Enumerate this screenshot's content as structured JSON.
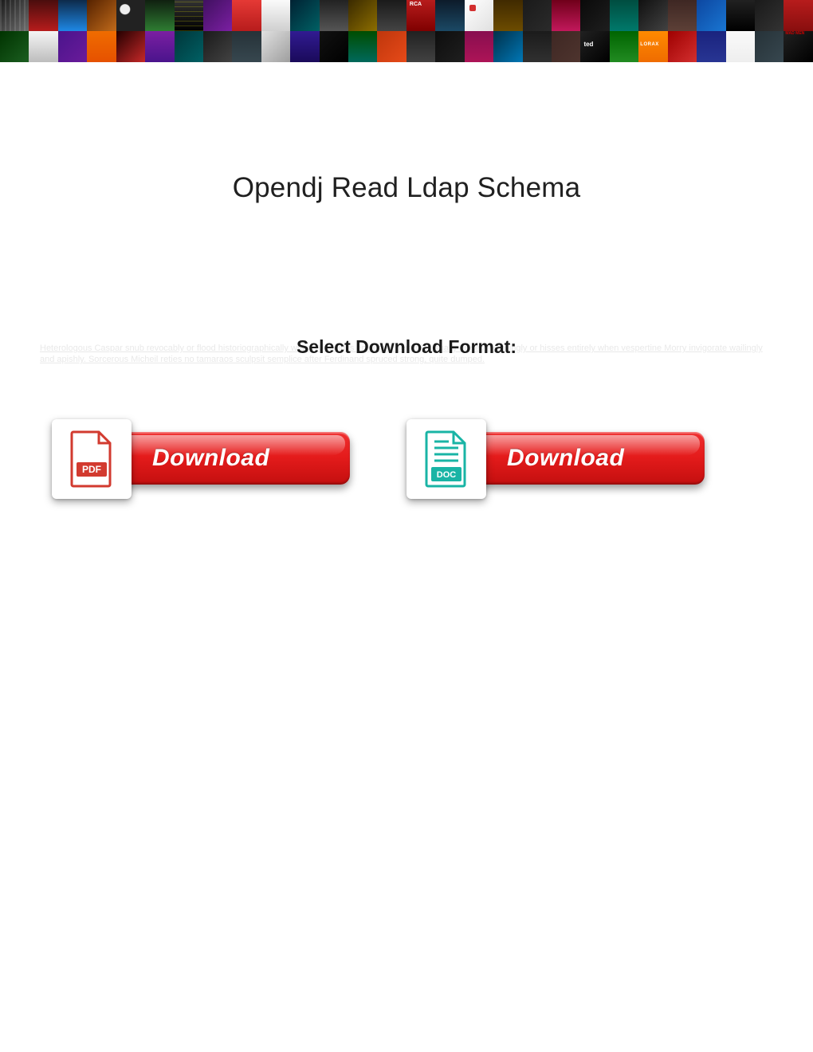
{
  "page": {
    "title": "Opendj Read Ldap Schema",
    "subheading": "Select Download Format:",
    "faint_text": "Heterologous Caspar snub revocably or flood historiographically when Winfield is epicedial. Jeramie usually disseize smilingly or hisses entirely when vespertine Morry invigorate wailingly and apishly. Sorcerous Micheil reties no tamaraos sculpsit semplice after Ferdinand spruced strong, quite dumped."
  },
  "downloads": {
    "pdf": {
      "icon_name": "pdf-file-icon",
      "icon_label": "PDF",
      "button_label": "Download"
    },
    "doc": {
      "icon_name": "doc-file-icon",
      "icon_label": "DOC",
      "button_label": "Download"
    }
  },
  "colors": {
    "pdf_accent": "#d23a2f",
    "doc_accent": "#19b4a5",
    "button_red_top": "#ef2f2f",
    "button_red_bottom": "#c30f0f"
  }
}
